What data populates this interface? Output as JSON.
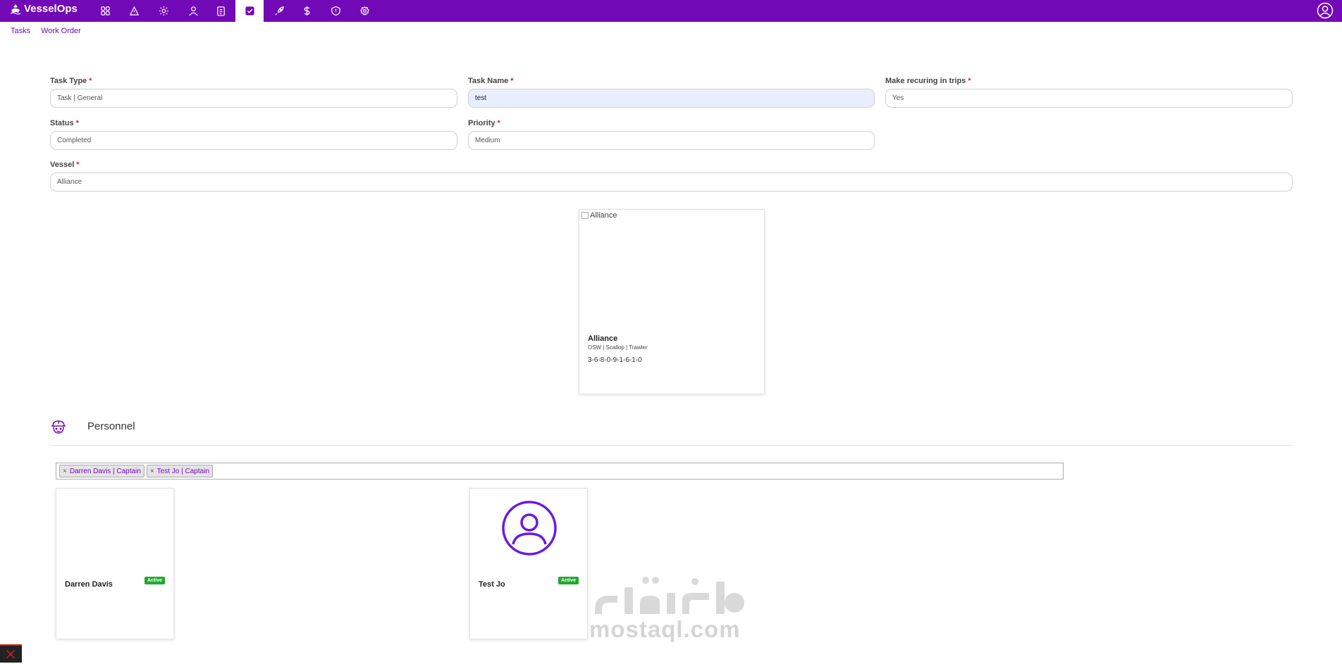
{
  "app": {
    "name": "VesselOps"
  },
  "nav": {
    "icons": [
      "grid-icon",
      "warning-icon",
      "gear-icon",
      "user-icon",
      "clipboard-icon",
      "check-icon",
      "rocket-icon",
      "dollar-icon",
      "shield-icon",
      "settings-icon"
    ],
    "active_index": 5
  },
  "breadcrumb": {
    "items": [
      "Tasks",
      "Work Order"
    ]
  },
  "form": {
    "task_type": {
      "label": "Task Type",
      "value": "Task | General"
    },
    "task_name": {
      "label": "Task Name",
      "value": "test"
    },
    "recurring": {
      "label": "Make recuring in trips",
      "value": "Yes"
    },
    "status": {
      "label": "Status",
      "value": "Completed"
    },
    "priority": {
      "label": "Priority",
      "value": "Medium"
    },
    "vessel": {
      "label": "Vessel",
      "value": "Alliance"
    },
    "required_mark": "*"
  },
  "vessel_card": {
    "image_alt": "Alliance",
    "name": "Alliance",
    "subtitle": "OSW | Scallop | Trawler",
    "number": "3-6-8-0-9-1-6-1-0"
  },
  "personnel": {
    "title": "Personnel",
    "tags": [
      {
        "label": "Darren Davis | Captain",
        "remove": "×"
      },
      {
        "label": "Test Jo | Captain",
        "remove": "×"
      }
    ],
    "cards": [
      {
        "name": "Darren Davis",
        "status": "Active"
      },
      {
        "name": "Test Jo",
        "status": "Active"
      }
    ]
  },
  "watermark": {
    "text": "mostaql.com"
  },
  "colors": {
    "brand": "#7209b7",
    "active_badge": "#22a82e",
    "required": "#e0202a"
  }
}
